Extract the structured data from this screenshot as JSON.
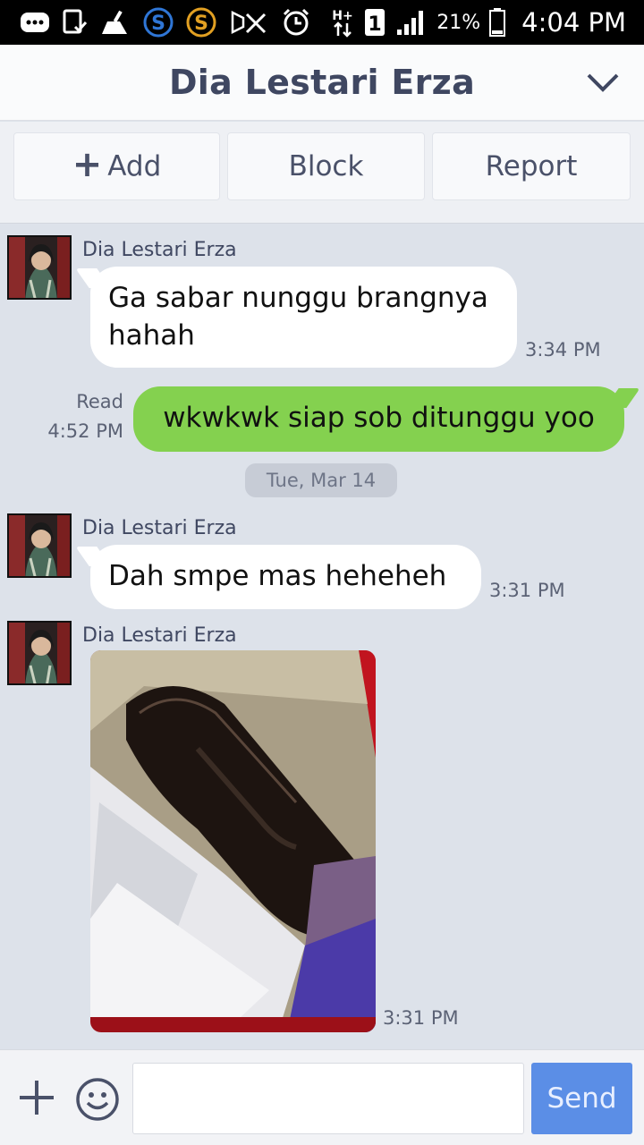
{
  "status_bar": {
    "battery_percent": "21%",
    "time": "4:04 PM",
    "sim_label": "1",
    "network_label": "H+",
    "icons": [
      "messages-icon",
      "screen-icon",
      "cleaner-icon",
      "s-blue-icon",
      "s-orange-icon",
      "mute-icon",
      "alarm-icon",
      "network-icon",
      "sim-icon",
      "signal-icon",
      "battery-icon"
    ]
  },
  "header": {
    "title": "Dia Lestari Erza",
    "menu_icon": "chevron-down-icon"
  },
  "actions": {
    "add_label": "Add",
    "block_label": "Block",
    "report_label": "Report"
  },
  "messages": [
    {
      "type": "incoming",
      "sender": "Dia Lestari Erza",
      "text_line1": "Ga sabar nunggu brangnya",
      "text_line2": "hahah",
      "time": "3:34 PM"
    },
    {
      "type": "outgoing",
      "text": "wkwkwk siap sob ditunggu yoo",
      "read_label": "Read",
      "time": "4:52 PM"
    },
    {
      "type": "date",
      "label": "Tue, Mar 14"
    },
    {
      "type": "incoming",
      "sender": "Dia Lestari Erza",
      "text": "Dah smpe mas heheheh",
      "time": "3:31 PM"
    },
    {
      "type": "incoming-image",
      "sender": "Dia Lestari Erza",
      "time": "3:31 PM"
    }
  ],
  "input_bar": {
    "placeholder": "",
    "send_label": "Send"
  },
  "colors": {
    "outgoing_bubble": "#84d14f",
    "incoming_bubble": "#ffffff",
    "chat_background": "#dde2ea",
    "send_button": "#5b8ee6",
    "header_text": "#3f4761"
  }
}
